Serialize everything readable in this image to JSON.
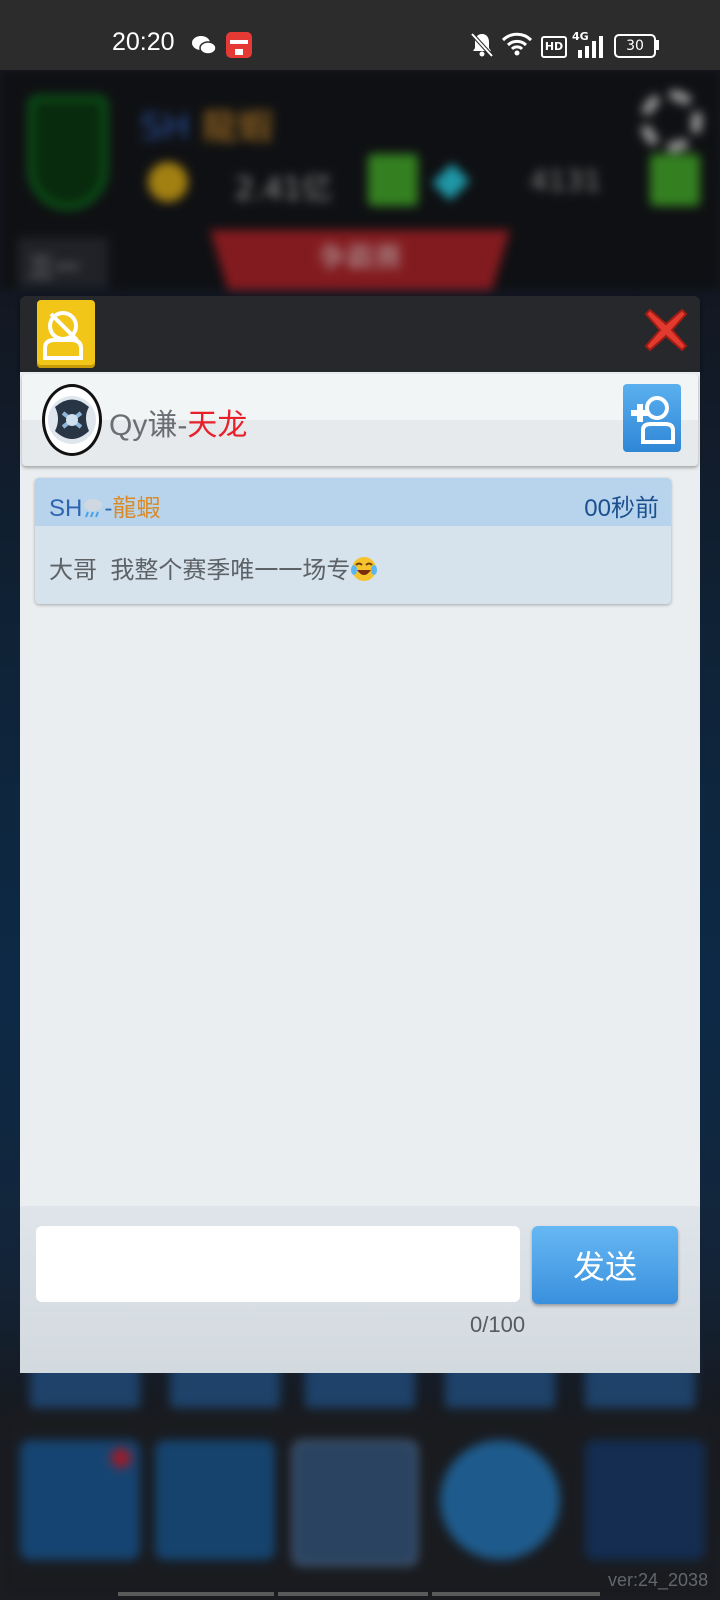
{
  "status_bar": {
    "time": "20:20",
    "icons": [
      "wechat-icon",
      "notification-app-icon",
      "mute-bell-icon",
      "wifi-icon",
      "hd-icon",
      "signal-4g-icon",
      "battery-icon"
    ],
    "network": "4G",
    "hd_label": "HD",
    "battery": "30"
  },
  "game_background": {
    "player_name_prefix": "SH",
    "player_name_suffix": "龍蝦",
    "gold": "2.41亿",
    "gems": "4131",
    "tab_left": "三一",
    "banner": "争霸赛",
    "version": "ver:24_2038"
  },
  "dialog": {
    "header": {
      "left_button_icon": "friend-manage-icon",
      "close_icon": "close-icon"
    },
    "friend": {
      "name_prefix": "Qy谦-",
      "name_suffix": "天龙",
      "add_button_icon": "add-friend-icon"
    },
    "messages": [
      {
        "sender_prefix": "SH",
        "sender_emoji": "rain-cloud-emoji",
        "sender_dash": "-",
        "sender_suffix": "龍蝦",
        "time": "00秒前",
        "text": "大哥  我整个赛季唯一一场专",
        "emoji": "tears-of-joy-emoji"
      }
    ],
    "composer": {
      "input_value": "",
      "placeholder": "",
      "send_label": "发送",
      "char_count": "0/100"
    }
  },
  "colors": {
    "name_red": "#e8202a",
    "sender_blue": "#2f65b0",
    "sender_orange": "#d98b2a",
    "send_button": "#4aa0e6",
    "header_yellow": "#f2c519"
  }
}
